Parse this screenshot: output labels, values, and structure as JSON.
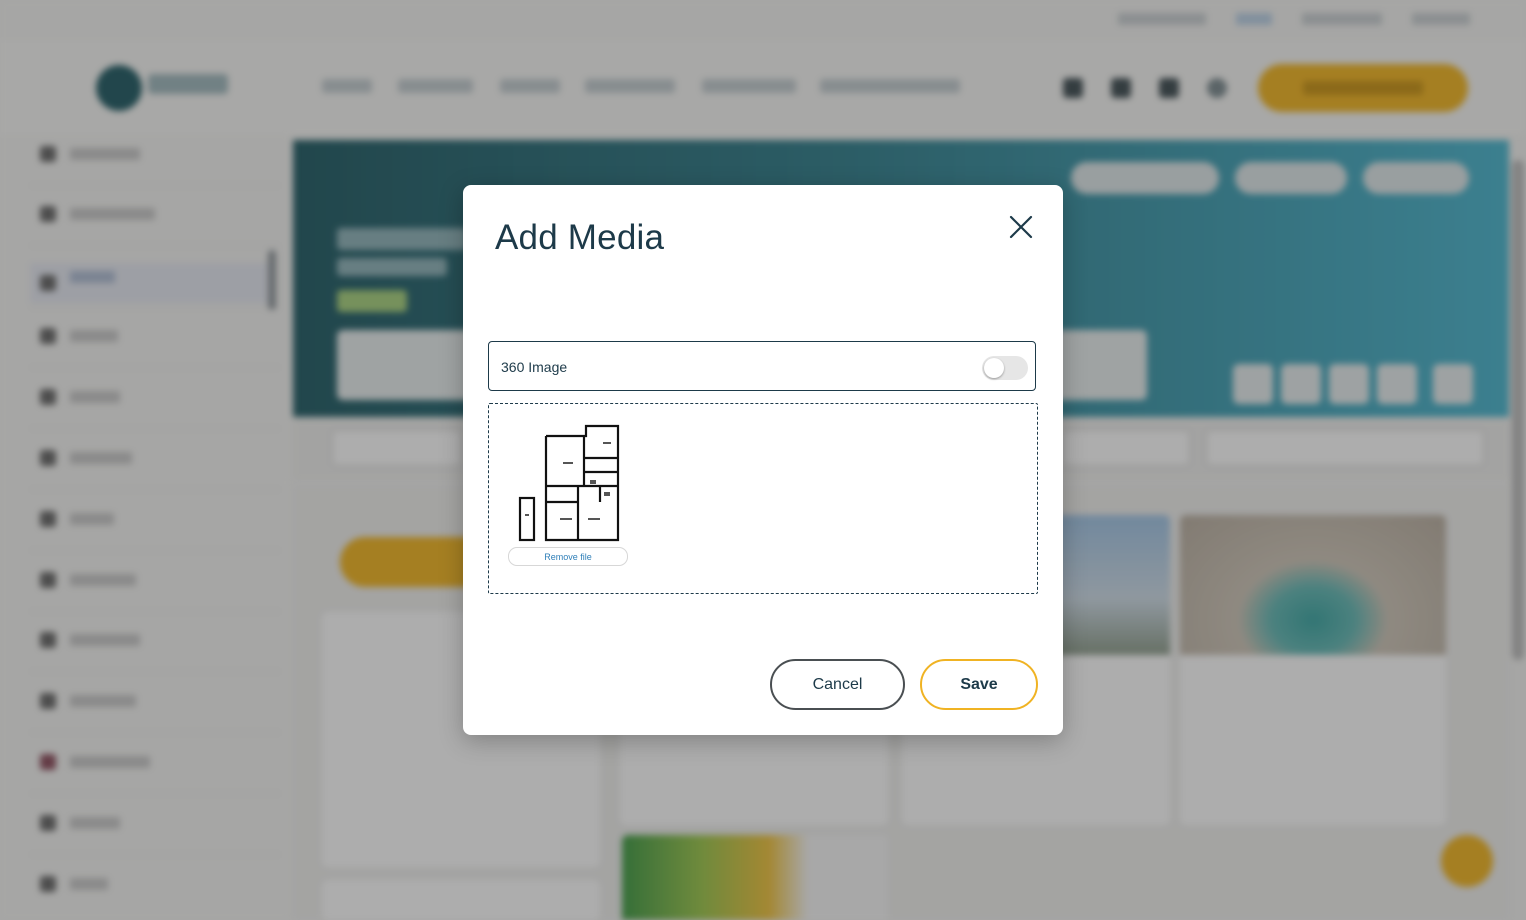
{
  "modal": {
    "title": "Add Media",
    "toggle_label": "360 Image",
    "toggle_on": false,
    "remove_file_label": "Remove file",
    "cancel_label": "Cancel",
    "save_label": "Save"
  },
  "icons": {
    "close": "close-icon",
    "file_thumbnail": "floorplan-thumbnail"
  },
  "colors": {
    "primary_dark": "#1d3a49",
    "accent": "#f0b323",
    "link": "#2f7fb8",
    "banner_start": "#1f5a63",
    "banner_end": "#49b6cf"
  }
}
